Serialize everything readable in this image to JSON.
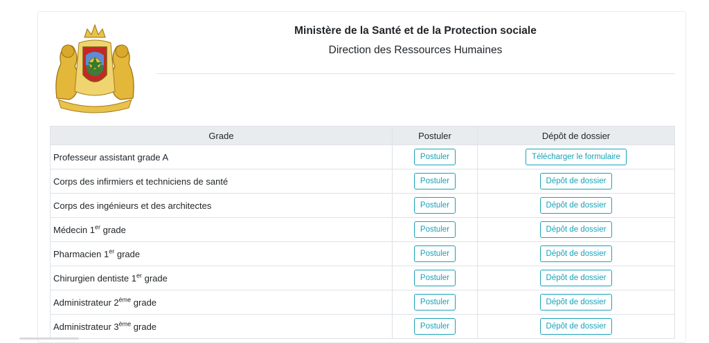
{
  "header": {
    "ministry": "Ministère de la Santé et de la Protection sociale",
    "direction": "Direction des Ressources Humaines",
    "emblem_icon": "moroccan-coat-of-arms-icon"
  },
  "table": {
    "columns": [
      "Grade",
      "Postuler",
      "Dépôt de dossier"
    ],
    "rows": [
      {
        "grade": "Professeur assistant grade A",
        "sup": "",
        "suffix": "",
        "apply": "Postuler",
        "deposit": "Télécharger le formulaire"
      },
      {
        "grade": "Corps des infirmiers et techniciens de santé",
        "sup": "",
        "suffix": "",
        "apply": "Postuler",
        "deposit": "Dépôt de dossier"
      },
      {
        "grade": "Corps des ingénieurs et des architectes",
        "sup": "",
        "suffix": "",
        "apply": "Postuler",
        "deposit": "Dépôt de dossier"
      },
      {
        "grade": "Médecin 1",
        "sup": "er",
        "suffix": " grade",
        "apply": "Postuler",
        "deposit": "Dépôt de dossier"
      },
      {
        "grade": "Pharmacien 1",
        "sup": "er",
        "suffix": " grade",
        "apply": "Postuler",
        "deposit": "Dépôt de dossier"
      },
      {
        "grade": "Chirurgien dentiste 1",
        "sup": "er",
        "suffix": " grade",
        "apply": "Postuler",
        "deposit": "Dépôt de dossier"
      },
      {
        "grade": "Administrateur 2",
        "sup": "ème",
        "suffix": " grade",
        "apply": "Postuler",
        "deposit": "Dépôt de dossier"
      },
      {
        "grade": "Administrateur 3",
        "sup": "ème",
        "suffix": " grade",
        "apply": "Postuler",
        "deposit": "Dépôt de dossier"
      }
    ]
  },
  "colors": {
    "button_accent": "#17a2b8",
    "header_bg": "#e9ecef",
    "border": "#dee2e6"
  }
}
